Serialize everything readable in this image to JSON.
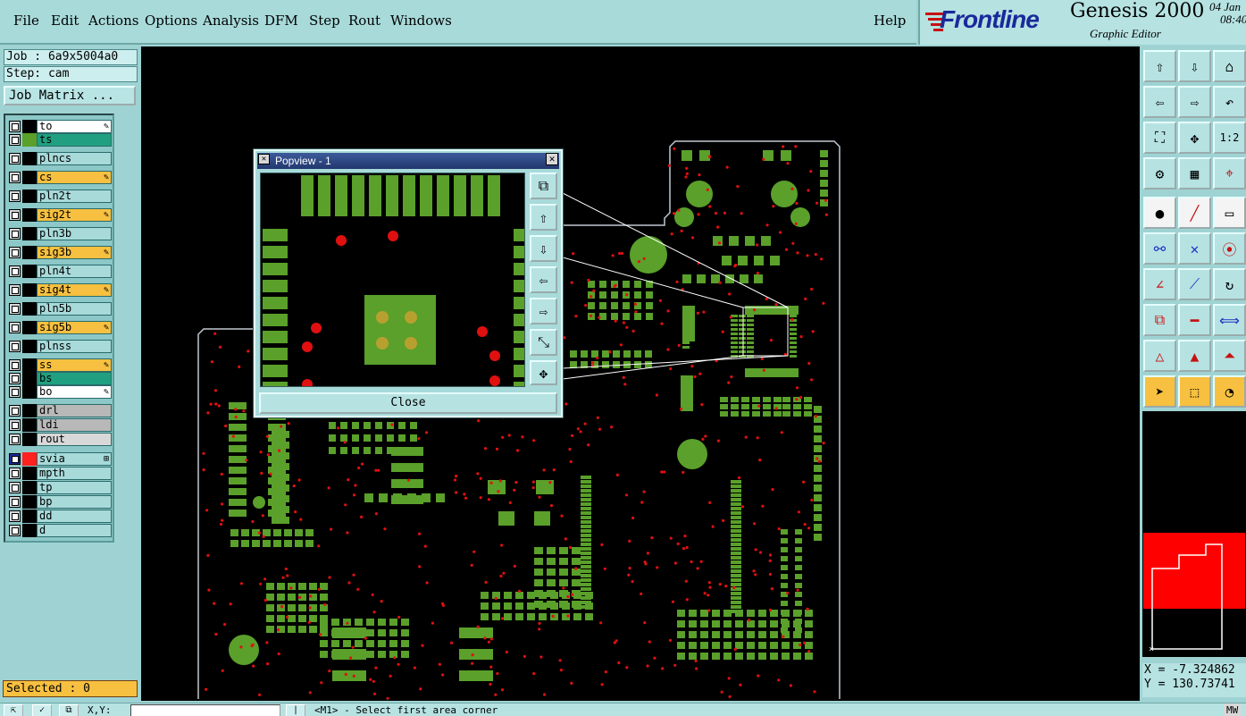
{
  "menu": {
    "items": [
      "File",
      "Edit",
      "Actions",
      "Options",
      "Analysis",
      "DFM",
      "Step",
      "Rout",
      "Windows"
    ],
    "help": "Help"
  },
  "brand": {
    "logo": "Frontline",
    "product": "Genesis 2000",
    "subtitle": "Graphic Editor",
    "date": "04  Jan",
    "time": "08:40"
  },
  "job": {
    "job_line": "Job : 6a9x5004a0",
    "step_line": "Step: cam",
    "matrix_button": "Job Matrix ..."
  },
  "layers": [
    {
      "name": "to",
      "bg": "#ffffff",
      "swatch": "#000000",
      "pen": true
    },
    {
      "name": "ts",
      "bg": "#20a080",
      "swatch": "#5aa02a",
      "pen": false
    },
    {
      "name": "plncs",
      "bg": "#a8dada",
      "swatch": "#000000",
      "pen": false
    },
    {
      "name": "cs",
      "bg": "#f7c040",
      "swatch": "#000000",
      "pen": true
    },
    {
      "name": "pln2t",
      "bg": "#a8dada",
      "swatch": "#000000",
      "pen": false
    },
    {
      "name": "sig2t",
      "bg": "#f7c040",
      "swatch": "#000000",
      "pen": true
    },
    {
      "name": "pln3b",
      "bg": "#a8dada",
      "swatch": "#000000",
      "pen": false
    },
    {
      "name": "sig3b",
      "bg": "#f7c040",
      "swatch": "#000000",
      "pen": true
    },
    {
      "name": "pln4t",
      "bg": "#a8dada",
      "swatch": "#000000",
      "pen": false
    },
    {
      "name": "sig4t",
      "bg": "#f7c040",
      "swatch": "#000000",
      "pen": true
    },
    {
      "name": "pln5b",
      "bg": "#a8dada",
      "swatch": "#000000",
      "pen": false
    },
    {
      "name": "sig5b",
      "bg": "#f7c040",
      "swatch": "#000000",
      "pen": true
    },
    {
      "name": "plnss",
      "bg": "#a8dada",
      "swatch": "#000000",
      "pen": false
    },
    {
      "name": "ss",
      "bg": "#f7c040",
      "swatch": "#000000",
      "pen": true
    },
    {
      "name": "bs",
      "bg": "#20a080",
      "swatch": "#000000",
      "pen": false
    },
    {
      "name": "bo",
      "bg": "#ffffff",
      "swatch": "#000000",
      "pen": true
    },
    {
      "name": "drl",
      "bg": "#b8b8b8",
      "swatch": "#000000",
      "pen": false
    },
    {
      "name": "ldi",
      "bg": "#b8b8b8",
      "swatch": "#000000",
      "pen": false
    },
    {
      "name": "rout",
      "bg": "#d8d8d8",
      "swatch": "#000000",
      "pen": false
    },
    {
      "name": "svia",
      "bg": "#a8dada",
      "swatch": "#ff2020",
      "pen": false,
      "grid": true,
      "active": true
    },
    {
      "name": "mpth",
      "bg": "#a8dada",
      "swatch": "#000000",
      "pen": false
    },
    {
      "name": "tp",
      "bg": "#a8dada",
      "swatch": "#000000",
      "pen": false
    },
    {
      "name": "bp",
      "bg": "#a8dada",
      "swatch": "#000000",
      "pen": false
    },
    {
      "name": "dd",
      "bg": "#a8dada",
      "swatch": "#000000",
      "pen": false
    },
    {
      "name": "d",
      "bg": "#a8dada",
      "swatch": "#000000",
      "pen": false
    }
  ],
  "selected": "Selected : 0",
  "popview": {
    "title": "Popview - 1",
    "close_label": "Close"
  },
  "coords": {
    "x": "X = -7.324862",
    "y": "Y = 130.73741"
  },
  "status": {
    "xy_label": "X,Y:",
    "message": "<M1> - Select first area corner",
    "mw": "MW"
  },
  "colors": {
    "pad_green": "#5aa02a",
    "via_red": "#e01010",
    "outline": "#bfc8d0",
    "accent_orange": "#f7c040"
  }
}
